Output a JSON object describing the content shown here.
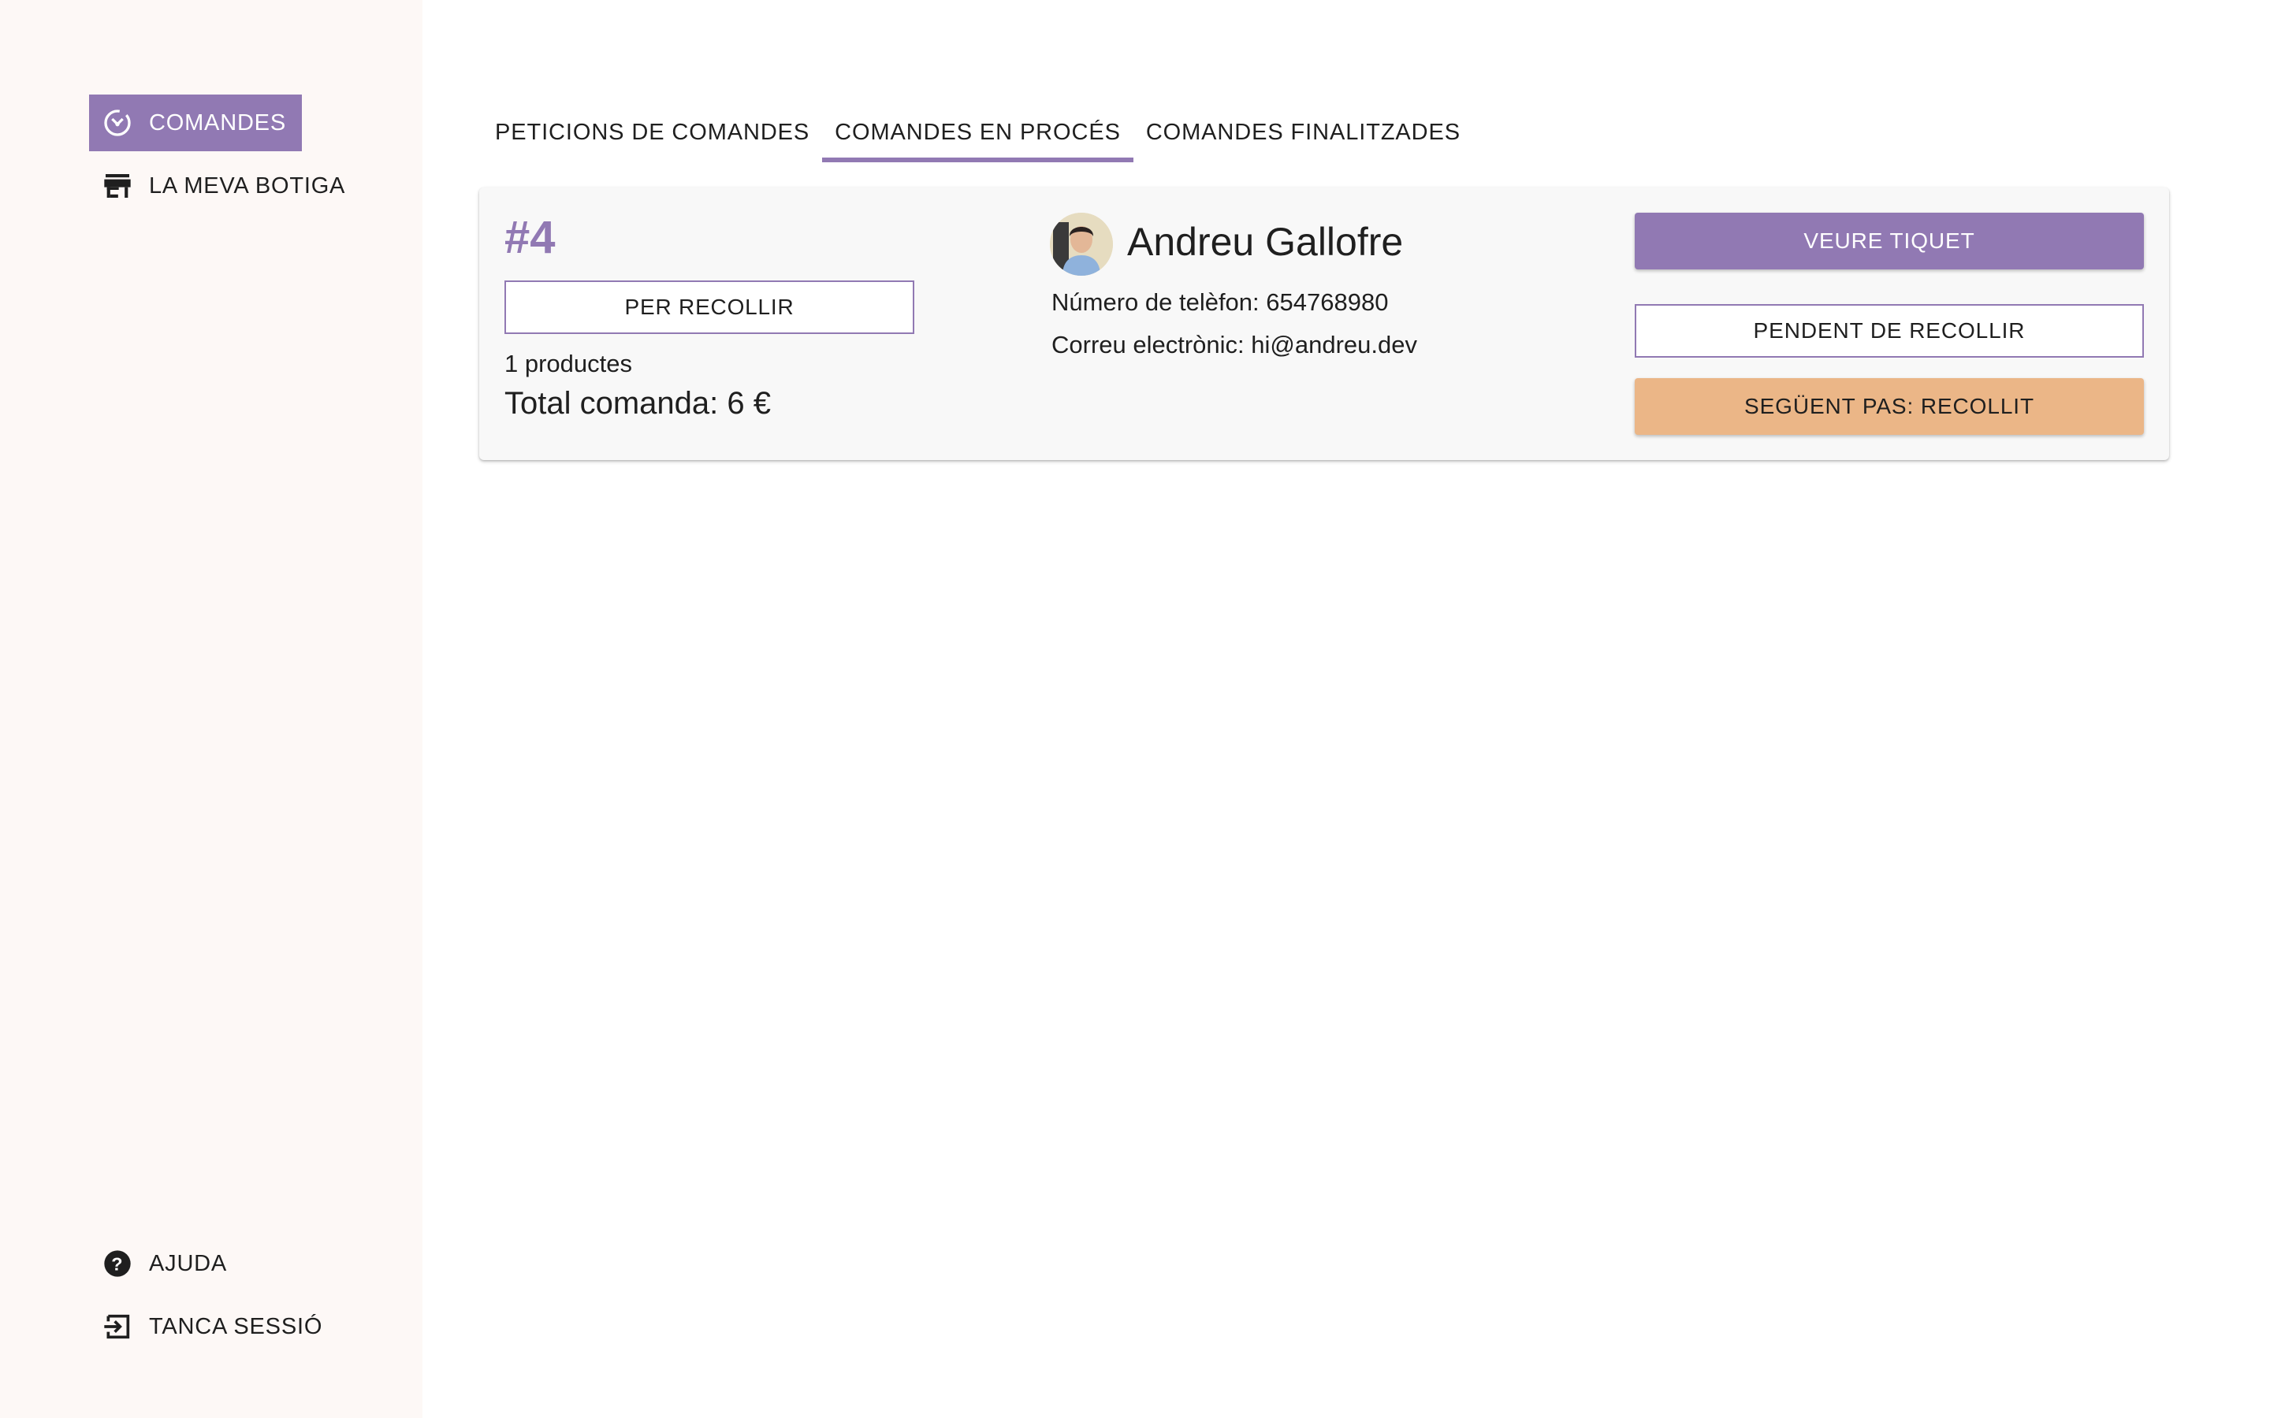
{
  "colors": {
    "accent": "#9179b3",
    "secondary": "#ebb687",
    "sidebar_bg": "#fdf8f6",
    "card_bg": "#f8f8f8"
  },
  "sidebar": {
    "items": [
      {
        "label": "COMANDES",
        "icon": "orders-timer-icon",
        "active": true
      },
      {
        "label": "LA MEVA BOTIGA",
        "icon": "store-icon",
        "active": false
      }
    ],
    "bottom_items": [
      {
        "label": "AJUDA",
        "icon": "help-icon"
      },
      {
        "label": "TANCA SESSIÓ",
        "icon": "logout-icon"
      }
    ]
  },
  "tabs": [
    {
      "label": "PETICIONS DE COMANDES",
      "active": false
    },
    {
      "label": "COMANDES EN PROCÉS",
      "active": true
    },
    {
      "label": "COMANDES FINALITZADES",
      "active": false
    }
  ],
  "order": {
    "number": "#4",
    "status": "PER RECOLLIR",
    "products": "1 productes",
    "total": "Total comanda: 6 €",
    "customer": {
      "name": "Andreu Gallofre",
      "phone": "Número de telèfon: 654768980",
      "email": "Correu electrònic: hi@andreu.dev"
    },
    "actions": {
      "ticket": "VEURE TIQUET",
      "pending": "PENDENT DE RECOLLIR",
      "next": "SEGÜENT PAS: RECOLLIT"
    }
  }
}
